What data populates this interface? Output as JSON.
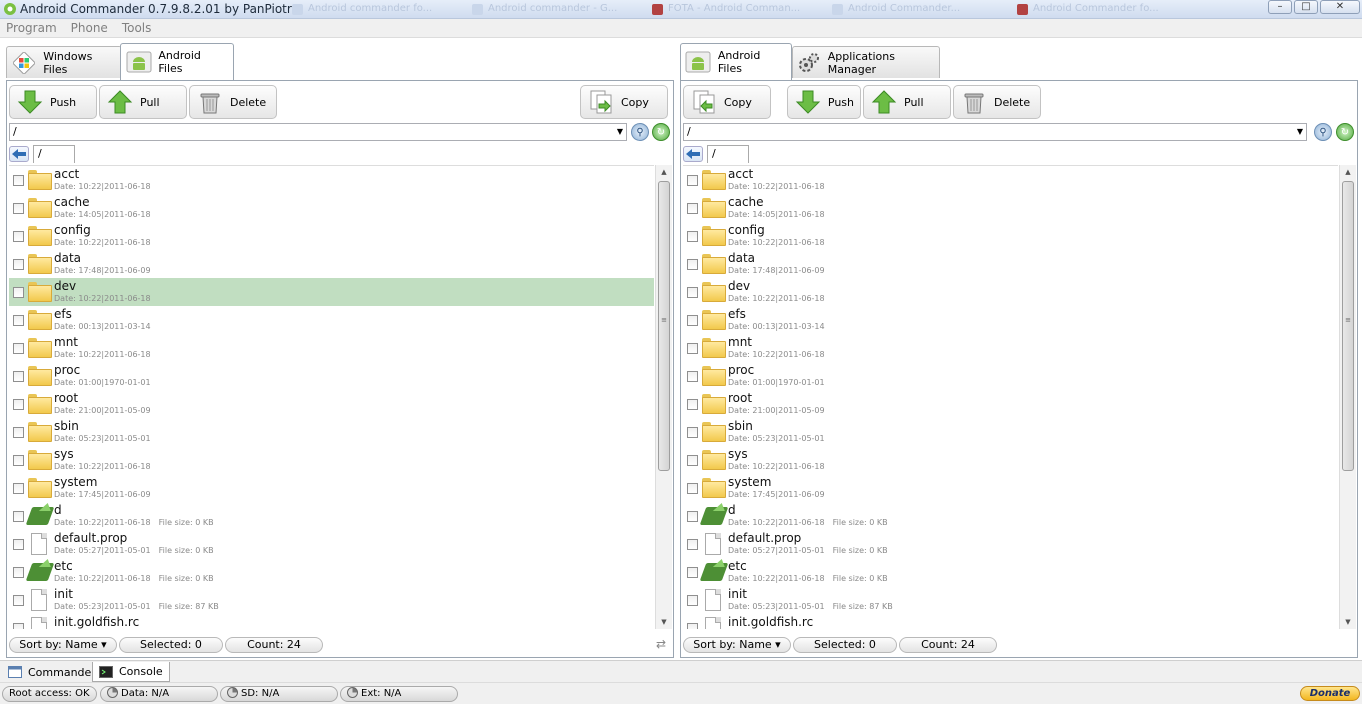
{
  "window": {
    "title": "Android Commander 0.7.9.8.2.01 by PanPiotr",
    "background_tabs": [
      "Android commander fo...",
      "Android commander - G...",
      "FOTA - Android Comman...",
      "Android Commander...",
      "Android Commander fo..."
    ]
  },
  "menubar": {
    "items": [
      "Program",
      "Phone",
      "Tools"
    ]
  },
  "left_panel": {
    "tabs": [
      "Windows Files",
      "Android Files"
    ],
    "active_tab": "Android Files",
    "toolbar": {
      "push": "Push",
      "pull": "Pull",
      "delete": "Delete",
      "copy": "Copy"
    },
    "path": "/",
    "breadcrumb": "/",
    "selected_row": 4,
    "status": {
      "sort": "Sort by: Name",
      "selected": "Selected: 0",
      "count": "Count: 24"
    }
  },
  "right_panel": {
    "tabs": [
      "Android Files",
      "Applications Manager"
    ],
    "active_tab": "Android Files",
    "toolbar": {
      "copy": "Copy",
      "push": "Push",
      "pull": "Pull",
      "delete": "Delete"
    },
    "path": "/",
    "breadcrumb": "/",
    "status": {
      "sort": "Sort by: Name",
      "selected": "Selected: 0",
      "count": "Count: 24"
    }
  },
  "files": [
    {
      "name": "acct",
      "date": "Date: 10:22|2011-06-18",
      "size": "",
      "type": "folder"
    },
    {
      "name": "cache",
      "date": "Date: 14:05|2011-06-18",
      "size": "",
      "type": "folder"
    },
    {
      "name": "config",
      "date": "Date: 10:22|2011-06-18",
      "size": "",
      "type": "folder"
    },
    {
      "name": "data",
      "date": "Date: 17:48|2011-06-09",
      "size": "",
      "type": "folder"
    },
    {
      "name": "dev",
      "date": "Date: 10:22|2011-06-18",
      "size": "",
      "type": "folder"
    },
    {
      "name": "efs",
      "date": "Date: 00:13|2011-03-14",
      "size": "",
      "type": "folder"
    },
    {
      "name": "mnt",
      "date": "Date: 10:22|2011-06-18",
      "size": "",
      "type": "folder"
    },
    {
      "name": "proc",
      "date": "Date: 01:00|1970-01-01",
      "size": "",
      "type": "folder"
    },
    {
      "name": "root",
      "date": "Date: 21:00|2011-05-09",
      "size": "",
      "type": "folder"
    },
    {
      "name": "sbin",
      "date": "Date: 05:23|2011-05-01",
      "size": "",
      "type": "folder"
    },
    {
      "name": "sys",
      "date": "Date: 10:22|2011-06-18",
      "size": "",
      "type": "folder"
    },
    {
      "name": "system",
      "date": "Date: 17:45|2011-06-09",
      "size": "",
      "type": "folder"
    },
    {
      "name": "d",
      "date": "Date: 10:22|2011-06-18",
      "size": "File size: 0 KB",
      "type": "link"
    },
    {
      "name": "default.prop",
      "date": "Date: 05:27|2011-05-01",
      "size": "File size: 0 KB",
      "type": "file"
    },
    {
      "name": "etc",
      "date": "Date: 10:22|2011-06-18",
      "size": "File size: 0 KB",
      "type": "link"
    },
    {
      "name": "init",
      "date": "Date: 05:23|2011-05-01",
      "size": "File size: 87 KB",
      "type": "file"
    },
    {
      "name": "init.goldfish.rc",
      "date": "",
      "size": "",
      "type": "file"
    }
  ],
  "bottom_tabs": [
    "Commander",
    "Console"
  ],
  "statusbar": {
    "root": "Root access: OK",
    "data": "Data: N/A",
    "sd": "SD: N/A",
    "ext": "Ext: N/A",
    "donate": "Donate"
  },
  "colors": {
    "selection": "#c1dec1",
    "accent_green": "#4d8f35",
    "folder": "#f2c94c"
  }
}
